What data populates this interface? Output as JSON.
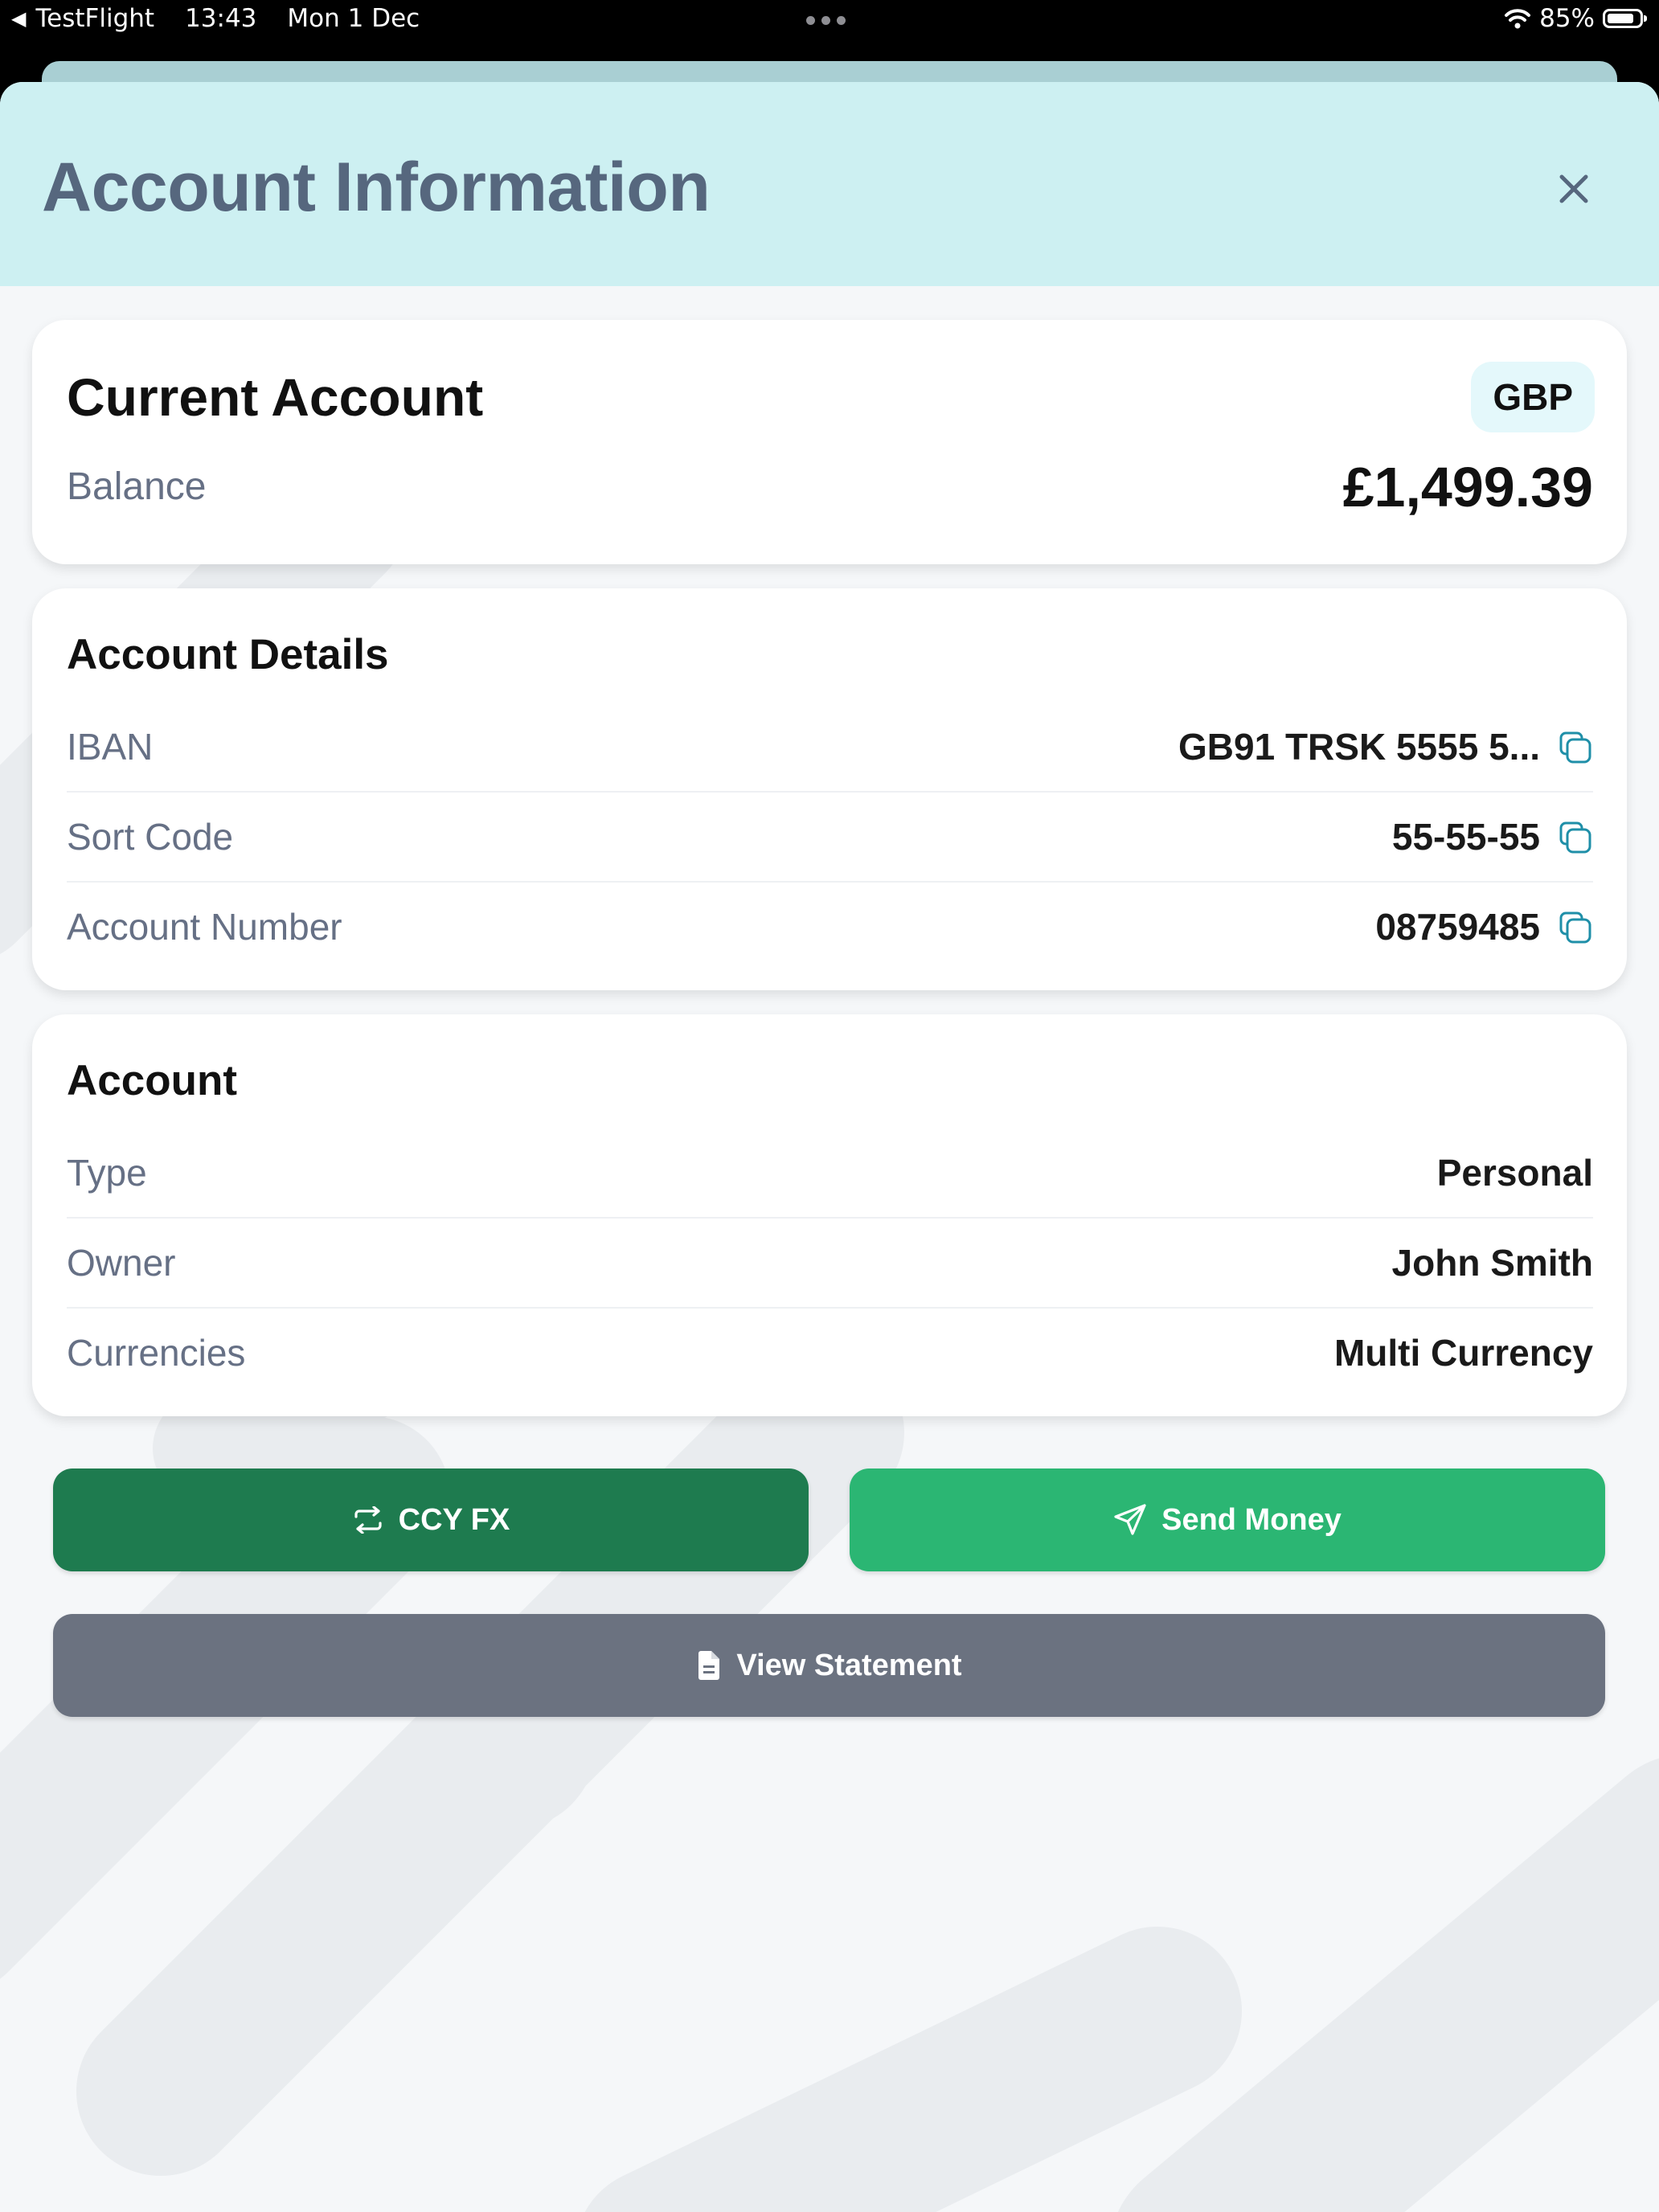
{
  "status_bar": {
    "back_app": "TestFlight",
    "time": "13:43",
    "date": "Mon 1 Dec",
    "battery": "85%",
    "battery_level": 0.85
  },
  "sheet": {
    "title": "Account Information",
    "close_icon": "close-icon"
  },
  "summary": {
    "account_name": "Current Account",
    "currency": "GBP",
    "balance_label": "Balance",
    "balance_value": "£1,499.39"
  },
  "details": {
    "title": "Account Details",
    "rows": [
      {
        "label": "IBAN",
        "value": "GB91 TRSK 5555 5...",
        "icon": "copy-icon"
      },
      {
        "label": "Sort Code",
        "value": "55-55-55",
        "icon": "copy-icon"
      },
      {
        "label": "Account Number",
        "value": "08759485",
        "icon": "copy-icon"
      }
    ]
  },
  "account": {
    "title": "Account",
    "rows": [
      {
        "label": "Type",
        "value": "Personal"
      },
      {
        "label": "Owner",
        "value": "John Smith"
      },
      {
        "label": "Currencies",
        "value": "Multi Currency"
      }
    ]
  },
  "actions": {
    "fx_label": "CCY FX",
    "fx_icon": "exchange-icon",
    "send_label": "Send Money",
    "send_icon": "paper-plane-icon",
    "statement_label": "View Statement",
    "statement_icon": "document-icon"
  },
  "colors": {
    "header_bg": "#cdf0f2",
    "title_text": "#56677e",
    "fx_button": "#1e7b4f",
    "send_button": "#2bb673",
    "statement_button": "#6b7280",
    "copy_icon": "#1f8fa8"
  }
}
